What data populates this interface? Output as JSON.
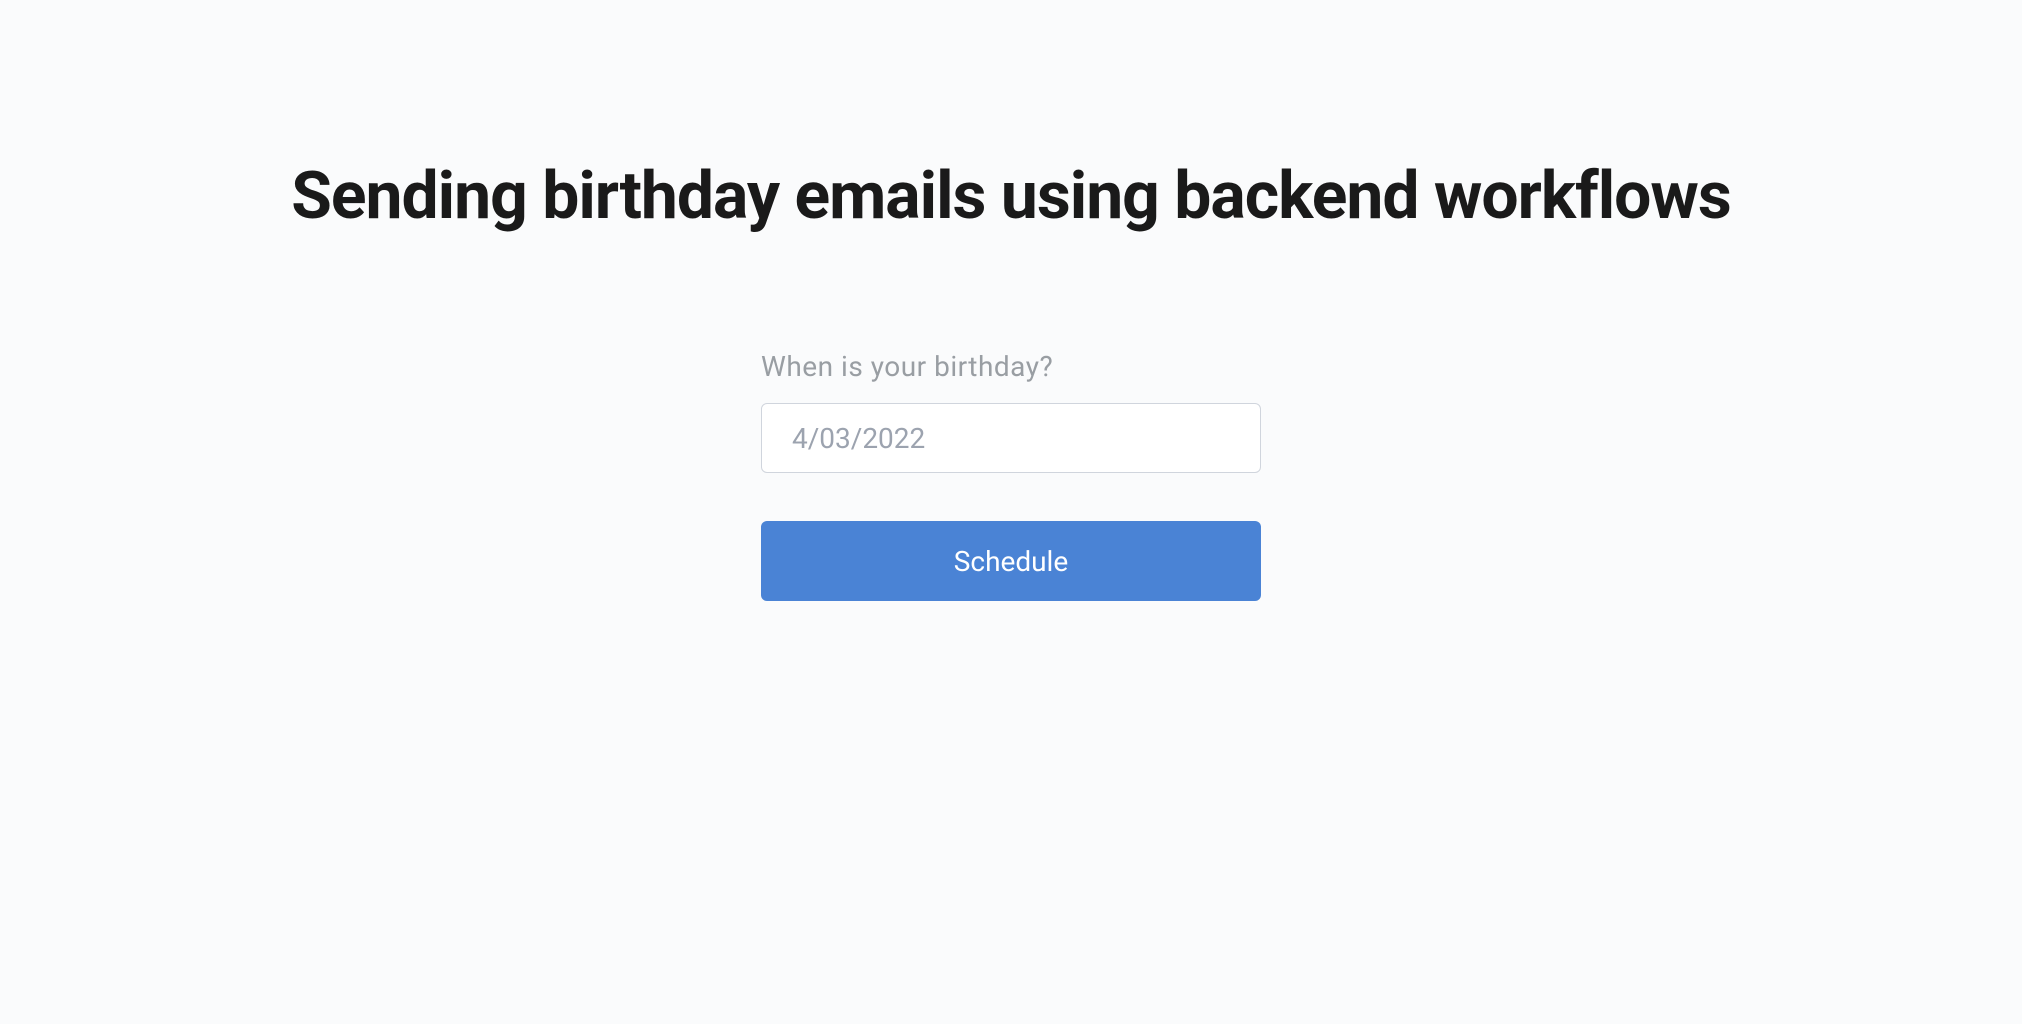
{
  "header": {
    "title": "Sending birthday emails using backend workflows"
  },
  "form": {
    "label": "When is your birthday?",
    "date_placeholder": "4/03/2022",
    "date_value": "",
    "button_label": "Schedule"
  }
}
